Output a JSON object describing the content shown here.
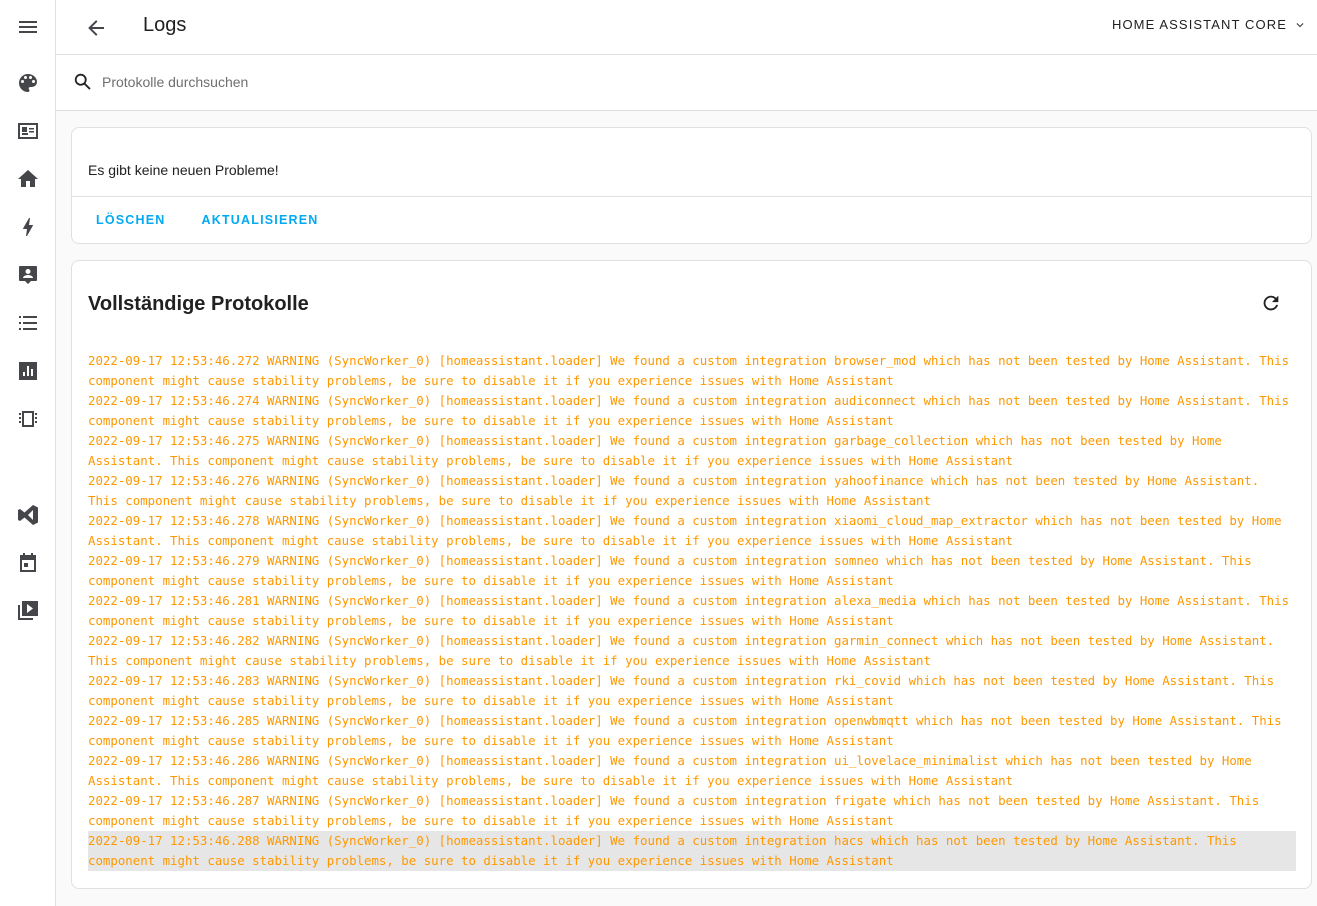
{
  "sidebar": {
    "icons": [
      {
        "name": "palette-icon"
      },
      {
        "name": "id-card-icon"
      },
      {
        "name": "home-icon"
      },
      {
        "name": "lightning-icon"
      },
      {
        "name": "account-box-icon"
      },
      {
        "name": "list-icon"
      },
      {
        "name": "chart-icon"
      },
      {
        "name": "memory-chip-icon"
      },
      {
        "name": "vscode-icon"
      },
      {
        "name": "calendar-icon"
      },
      {
        "name": "media-icon"
      }
    ]
  },
  "header": {
    "title": "Logs",
    "source_select": "HOME ASSISTANT CORE"
  },
  "search": {
    "placeholder": "Protokolle durchsuchen"
  },
  "issues_card": {
    "message": "Es gibt keine neuen Probleme!",
    "clear_label": "LÖSCHEN",
    "refresh_label": "AKTUALISIEREN"
  },
  "logs_card": {
    "title": "Vollständige Protokolle",
    "lines": [
      "2022-09-17 12:53:46.272 WARNING (SyncWorker_0) [homeassistant.loader] We found a custom integration browser_mod which has not been tested by Home Assistant. This component might cause stability problems, be sure to disable it if you experience issues with Home Assistant",
      "2022-09-17 12:53:46.274 WARNING (SyncWorker_0) [homeassistant.loader] We found a custom integration audiconnect which has not been tested by Home Assistant. This component might cause stability problems, be sure to disable it if you experience issues with Home Assistant",
      "2022-09-17 12:53:46.275 WARNING (SyncWorker_0) [homeassistant.loader] We found a custom integration garbage_collection which has not been tested by Home Assistant. This component might cause stability problems, be sure to disable it if you experience issues with Home Assistant",
      "2022-09-17 12:53:46.276 WARNING (SyncWorker_0) [homeassistant.loader] We found a custom integration yahoofinance which has not been tested by Home Assistant. This component might cause stability problems, be sure to disable it if you experience issues with Home Assistant",
      "2022-09-17 12:53:46.278 WARNING (SyncWorker_0) [homeassistant.loader] We found a custom integration xiaomi_cloud_map_extractor which has not been tested by Home Assistant. This component might cause stability problems, be sure to disable it if you experience issues with Home Assistant",
      "2022-09-17 12:53:46.279 WARNING (SyncWorker_0) [homeassistant.loader] We found a custom integration somneo which has not been tested by Home Assistant. This component might cause stability problems, be sure to disable it if you experience issues with Home Assistant",
      "2022-09-17 12:53:46.281 WARNING (SyncWorker_0) [homeassistant.loader] We found a custom integration alexa_media which has not been tested by Home Assistant. This component might cause stability problems, be sure to disable it if you experience issues with Home Assistant",
      "2022-09-17 12:53:46.282 WARNING (SyncWorker_0) [homeassistant.loader] We found a custom integration garmin_connect which has not been tested by Home Assistant. This component might cause stability problems, be sure to disable it if you experience issues with Home Assistant",
      "2022-09-17 12:53:46.283 WARNING (SyncWorker_0) [homeassistant.loader] We found a custom integration rki_covid which has not been tested by Home Assistant. This component might cause stability problems, be sure to disable it if you experience issues with Home Assistant",
      "2022-09-17 12:53:46.285 WARNING (SyncWorker_0) [homeassistant.loader] We found a custom integration openwbmqtt which has not been tested by Home Assistant. This component might cause stability problems, be sure to disable it if you experience issues with Home Assistant",
      "2022-09-17 12:53:46.286 WARNING (SyncWorker_0) [homeassistant.loader] We found a custom integration ui_lovelace_minimalist which has not been tested by Home Assistant. This component might cause stability problems, be sure to disable it if you experience issues with Home Assistant",
      "2022-09-17 12:53:46.287 WARNING (SyncWorker_0) [homeassistant.loader] We found a custom integration frigate which has not been tested by Home Assistant. This component might cause stability problems, be sure to disable it if you experience issues with Home Assistant",
      "2022-09-17 12:53:46.288 WARNING (SyncWorker_0) [homeassistant.loader] We found a custom integration hacs which has not been tested by Home Assistant. This component might cause stability problems, be sure to disable it if you experience issues with Home Assistant"
    ]
  },
  "colors": {
    "accent": "#03a9f4",
    "warning": "#ff9800",
    "highlight": "#e6e6e6"
  }
}
